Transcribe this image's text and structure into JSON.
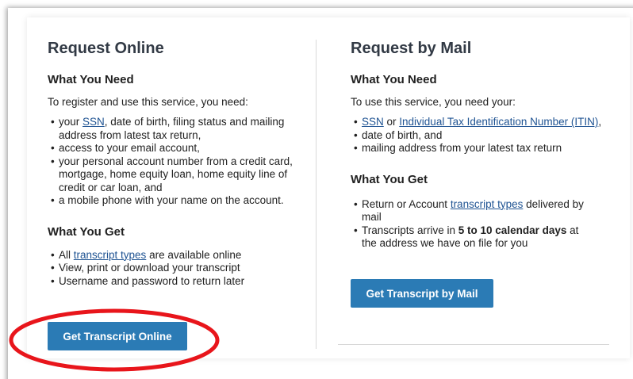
{
  "online": {
    "title": "Request Online",
    "need_heading": "What You Need",
    "need_intro": "To register and use this service, you need:",
    "need_items": [
      {
        "pre": "your ",
        "link": "SSN",
        "post": ", date of birth, filing status and mailing address from latest tax return,"
      },
      {
        "text": "access to your email account,"
      },
      {
        "text": "your personal account number from a credit card, mortgage, home equity loan, home equity line of credit or car loan, and"
      },
      {
        "text": "a mobile phone with your name on the account."
      }
    ],
    "get_heading": "What You Get",
    "get_items": [
      {
        "pre": "All ",
        "link": "transcript types",
        "post": " are available online"
      },
      {
        "text": "View, print or download your transcript"
      },
      {
        "text": "Username and password to return later"
      }
    ],
    "button_label": "Get Transcript Online"
  },
  "mail": {
    "title": "Request by Mail",
    "need_heading": "What You Need",
    "need_intro": "To use this service, you need your:",
    "need_items": [
      {
        "link": "SSN",
        "mid": " or ",
        "link2": "Individual Tax Identification Number (ITIN)",
        "post": ","
      },
      {
        "text": "date of birth, and"
      },
      {
        "text": "mailing address from your latest tax return"
      }
    ],
    "get_heading": "What You Get",
    "get_items": [
      {
        "pre": "Return or Account ",
        "link": "transcript types",
        "post": " delivered by mail"
      },
      {
        "pre": "Transcripts arrive in ",
        "strong": "5 to 10 calendar days",
        "post": " at the address we have on file for you"
      }
    ],
    "button_label": "Get Transcript by Mail"
  },
  "colors": {
    "button_bg": "#2b7bb5",
    "link": "#205493",
    "annotation_ring": "#e8151b"
  }
}
